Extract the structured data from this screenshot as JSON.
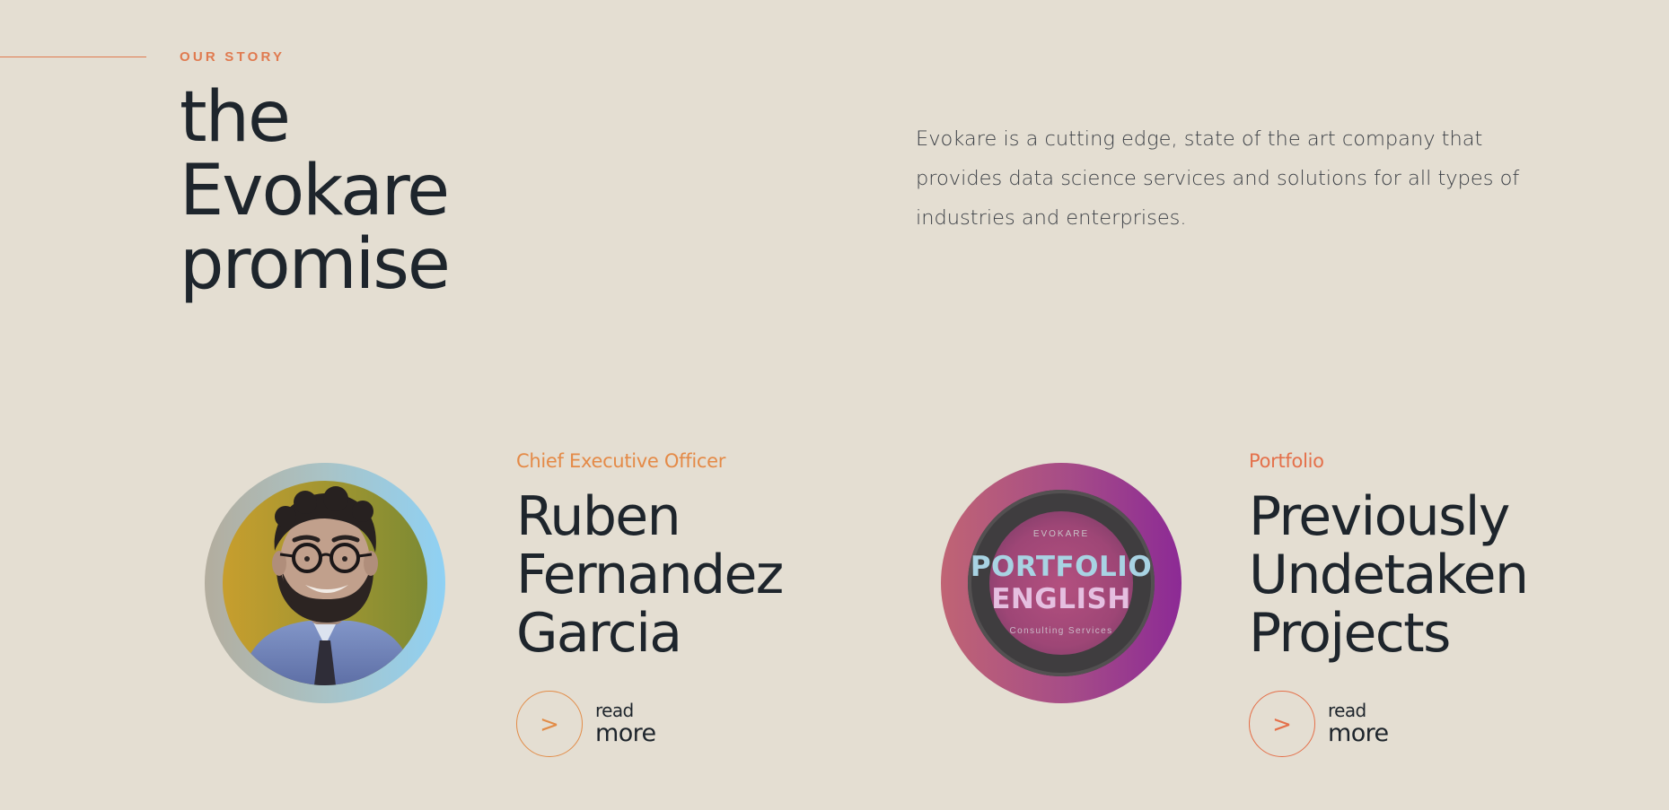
{
  "story": {
    "eyebrow": "OUR STORY",
    "headline_lines": [
      "the",
      "Evokare",
      "promise"
    ],
    "description": "Evokare is a cutting edge, state of the art company that provides data science services and solutions for all types of industries and enterprises."
  },
  "cards": [
    {
      "label": "Chief Executive Officer",
      "title_lines": [
        "Ruben",
        "Fernandez",
        "Garcia"
      ],
      "image_name": "ceo-portrait-photo",
      "read_more": {
        "icon": ">",
        "line1": "read",
        "line2": "more"
      }
    },
    {
      "label": "Portfolio",
      "title_lines": [
        "Previously",
        "Undetaken",
        "Projects"
      ],
      "image_name": "portfolio-cover-image",
      "image_text": {
        "brand": "EVOKARE",
        "title_line1": "PORTFOLIO",
        "title_line2": "ENGLISH",
        "subtitle": "Consulting Services"
      },
      "read_more": {
        "icon": ">",
        "line1": "read",
        "line2": "more"
      }
    }
  ],
  "colors": {
    "background": "#e4ded2",
    "text_dark": "#1e252c",
    "accent_orange": "#e48a47",
    "accent_coral": "#e4704a"
  }
}
